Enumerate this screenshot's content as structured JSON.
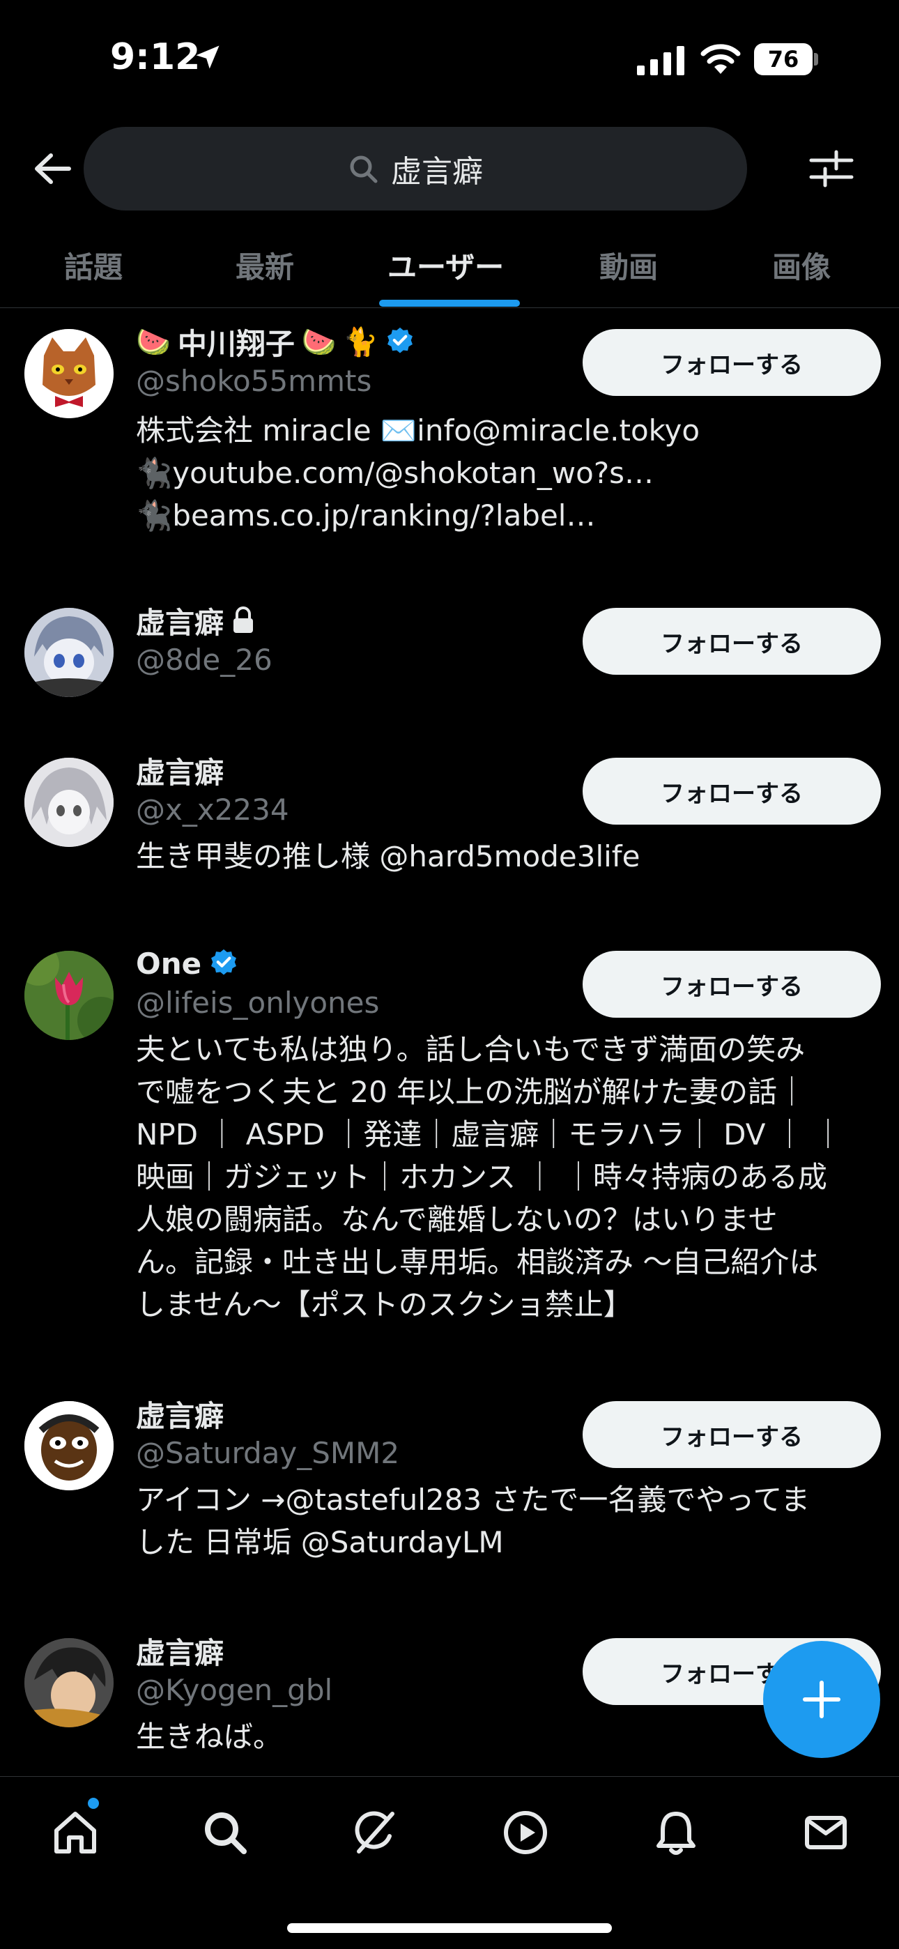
{
  "status_bar": {
    "time": "9:12",
    "battery": "76"
  },
  "search": {
    "query": "虚言癖"
  },
  "tabs": [
    {
      "label": "話題"
    },
    {
      "label": "最新"
    },
    {
      "label": "ユーザー"
    },
    {
      "label": "動画"
    },
    {
      "label": "画像"
    }
  ],
  "users": [
    {
      "name": "中川翔子",
      "handle": "@shoko55mmts",
      "follow_label": "フォローする",
      "bio_lines": [
        "株式会社 miracle ✉️info@miracle.tokyo",
        "🐈‍⬛youtube.com/@shokotan_wo?s…",
        "🐈‍⬛beams.co.jp/ranking/?label…"
      ]
    },
    {
      "name": "虚言癖",
      "handle": "@8de_26",
      "follow_label": "フォローする"
    },
    {
      "name": "虚言癖",
      "handle": "@x_x2234",
      "follow_label": "フォローする",
      "bio": "生き甲斐の推し様 @hard5mode3life"
    },
    {
      "name": "One",
      "handle": "@lifeis_onlyones",
      "follow_label": "フォローする",
      "bio_lines": [
        "夫といても私は独り。話し合いもできず満面の笑み",
        "で嘘をつく夫と 20 年以上の洗脳が解けた妻の話｜",
        "NPD ｜ ASPD ｜発達｜虚言癖｜モラハラ｜ DV ｜ ｜",
        "映画｜ガジェット｜ホカンス ｜ ｜時々持病のある成",
        "人娘の闘病話。なんで離婚しないの？はいりませ",
        "ん。記録・吐き出し専用垢。相談済み 〜自己紹介は",
        "しません〜【ポストのスクショ禁止】"
      ]
    },
    {
      "name": "虚言癖",
      "handle": "@Saturday_SMM2",
      "follow_label": "フォローする",
      "bio_lines": [
        "アイコン →@tasteful283 さたで一名義でやってま",
        "した 日常垢 @SaturdayLM"
      ]
    },
    {
      "name": "虚言癖",
      "handle": "@Kyogen_gbl",
      "follow_label": "フォローする",
      "bio": "生きねば。"
    }
  ],
  "colors": {
    "accent": "#1d9bf0",
    "background": "#000000",
    "secondary_text": "#71767b",
    "follow_bg": "#eff3f4"
  }
}
